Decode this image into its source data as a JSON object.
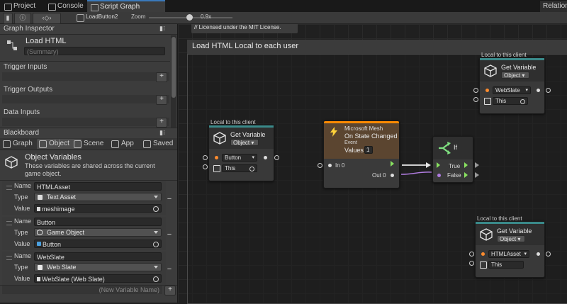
{
  "tabs": [
    {
      "label": "Project",
      "icon": "folder-icon"
    },
    {
      "label": "Console",
      "icon": "console-icon"
    },
    {
      "label": "Script Graph",
      "icon": "script-graph-icon"
    }
  ],
  "right_tab": "Relation",
  "toolbar": {
    "breadcrumb": "LoadButton2",
    "zoom_label": "Zoom",
    "zoom_value": "0.9x",
    "zoom_fraction": 0.48
  },
  "graph_inspector": {
    "header": "Graph Inspector",
    "graph_name": "Load HTML",
    "summary_placeholder": "(Summary)",
    "sections": [
      "Trigger Inputs",
      "Trigger Outputs",
      "Data Inputs"
    ]
  },
  "blackboard": {
    "header": "Blackboard",
    "tabs": [
      "Graph",
      "Object",
      "Scene",
      "App",
      "Saved"
    ],
    "active_tab": "Object",
    "title": "Object Variables",
    "description": "These variables are shared across the current game object.",
    "field_labels": {
      "name": "Name",
      "type": "Type",
      "value": "Value"
    },
    "variables": [
      {
        "name": "HTMLAsset",
        "type": "Text Asset",
        "value": "meshimage"
      },
      {
        "name": "Button",
        "type": "Game Object",
        "value": "Button"
      },
      {
        "name": "WebSlate",
        "type": "Web Slate",
        "value": "WebSlate (Web Slate)"
      }
    ],
    "new_variable_placeholder": "(New Variable Name)"
  },
  "graph": {
    "comment": "// Licensed under the MIT License.",
    "group_title": "Load HTML Local to each user",
    "nodes": {
      "get_var_button": {
        "context": "Local to this client",
        "title": "Get Variable",
        "kind": "Object",
        "var": "Button",
        "target": "This"
      },
      "state_changed": {
        "subtitle": "Microsoft Mesh",
        "title": "On State Changed",
        "event_label": "Event",
        "values_label": "Values",
        "values_count": "1",
        "in_label": "In 0",
        "out_label": "Out 0"
      },
      "if": {
        "title": "If",
        "true_label": "True",
        "false_label": "False"
      },
      "get_var_webslate": {
        "context": "Local to this client",
        "title": "Get Variable",
        "kind": "Object",
        "var": "WebSlate",
        "target": "This"
      },
      "get_var_htmlasset": {
        "context": "Local to this client",
        "title": "Get Variable",
        "kind": "Object",
        "var": "HTMLAsset",
        "target": "This"
      }
    }
  },
  "colors": {
    "accent": "#3a79bb",
    "event_header": "#ff8a00",
    "node_stripe": "#3a8a8a",
    "flow": "#88e060",
    "bool_port": "#b07ce0"
  }
}
